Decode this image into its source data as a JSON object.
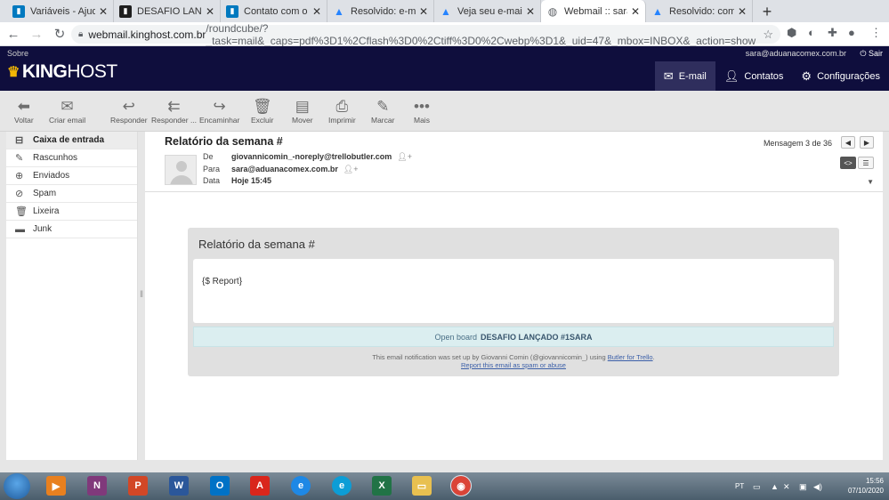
{
  "browser": {
    "tabs": [
      {
        "title": "Variáveis - Ajuda d",
        "icon": "trello-icon",
        "color": "#0079bf"
      },
      {
        "title": "DESAFIO LANÇADO",
        "icon": "trello-icon",
        "color": "#1e1e1e"
      },
      {
        "title": "Contato com o Sup",
        "icon": "trello-icon",
        "color": "#0079bf"
      },
      {
        "title": "Resolvido: e-mail a",
        "icon": "atlassian-icon",
        "color": "#2684ff"
      },
      {
        "title": "Veja seu e-mail - E",
        "icon": "atlassian-icon",
        "color": "#2684ff"
      },
      {
        "title": "Webmail :: sara@a",
        "icon": "globe-icon",
        "color": "#5f6368",
        "active": true
      },
      {
        "title": "Resolvido: como g",
        "icon": "atlassian-icon",
        "color": "#2684ff"
      }
    ],
    "url_host": "webmail.kinghost.com.br",
    "url_path": "/roundcube/?_task=mail&_caps=pdf%3D1%2Cflash%3D0%2Ctiff%3D0%2Cwebp%3D1&_uid=47&_mbox=INBOX&_action=show"
  },
  "header": {
    "sobre": "Sobre",
    "logo_bold": "KING",
    "logo_rest": "HOST",
    "user_email": "sara@aduanacomex.com.br",
    "logout": "Sair",
    "nav": [
      {
        "label": "E-mail",
        "icon": "envelope-icon",
        "active": true
      },
      {
        "label": "Contatos",
        "icon": "person-icon"
      },
      {
        "label": "Configurações",
        "icon": "gear-icon"
      }
    ]
  },
  "toolbar": {
    "back": "Voltar",
    "compose": "Criar email",
    "reply": "Responder",
    "reply_all": "Responder ...",
    "forward": "Encaminhar",
    "delete": "Excluir",
    "move": "Mover",
    "print": "Imprimir",
    "mark": "Marcar",
    "more": "Mais"
  },
  "folders": [
    {
      "label": "Caixa de entrada",
      "icon": "inbox-icon",
      "selected": true
    },
    {
      "label": "Rascunhos",
      "icon": "pencil-icon"
    },
    {
      "label": "Enviados",
      "icon": "sent-icon"
    },
    {
      "label": "Spam",
      "icon": "spam-icon"
    },
    {
      "label": "Lixeira",
      "icon": "trash-icon"
    },
    {
      "label": "Junk",
      "icon": "folder-icon"
    }
  ],
  "message": {
    "subject": "Relatório da semana #",
    "from_label": "De",
    "from": "giovannicomin_-noreply@trellobutler.com",
    "to_label": "Para",
    "to": "sara@aduanacomex.com.br",
    "date_label": "Data",
    "date": "Hoje 15:45",
    "counter": "Mensagem 3 de 36"
  },
  "email_body": {
    "title": "Relatório da semana #",
    "report": "{$ Report}",
    "open_board_prefix": "Open board",
    "board_name": "DESAFIO LANÇADO #1SARA",
    "note_prefix": "This email notification was set up by Giovanni Comin (@giovannicomin_) using",
    "note_link": "Butler for Trello",
    "note_suffix": ".",
    "spam_link": "Report this email as spam or abuse"
  },
  "taskbar": {
    "lang": "PT",
    "time": "15:56",
    "date": "07/10/2020"
  }
}
